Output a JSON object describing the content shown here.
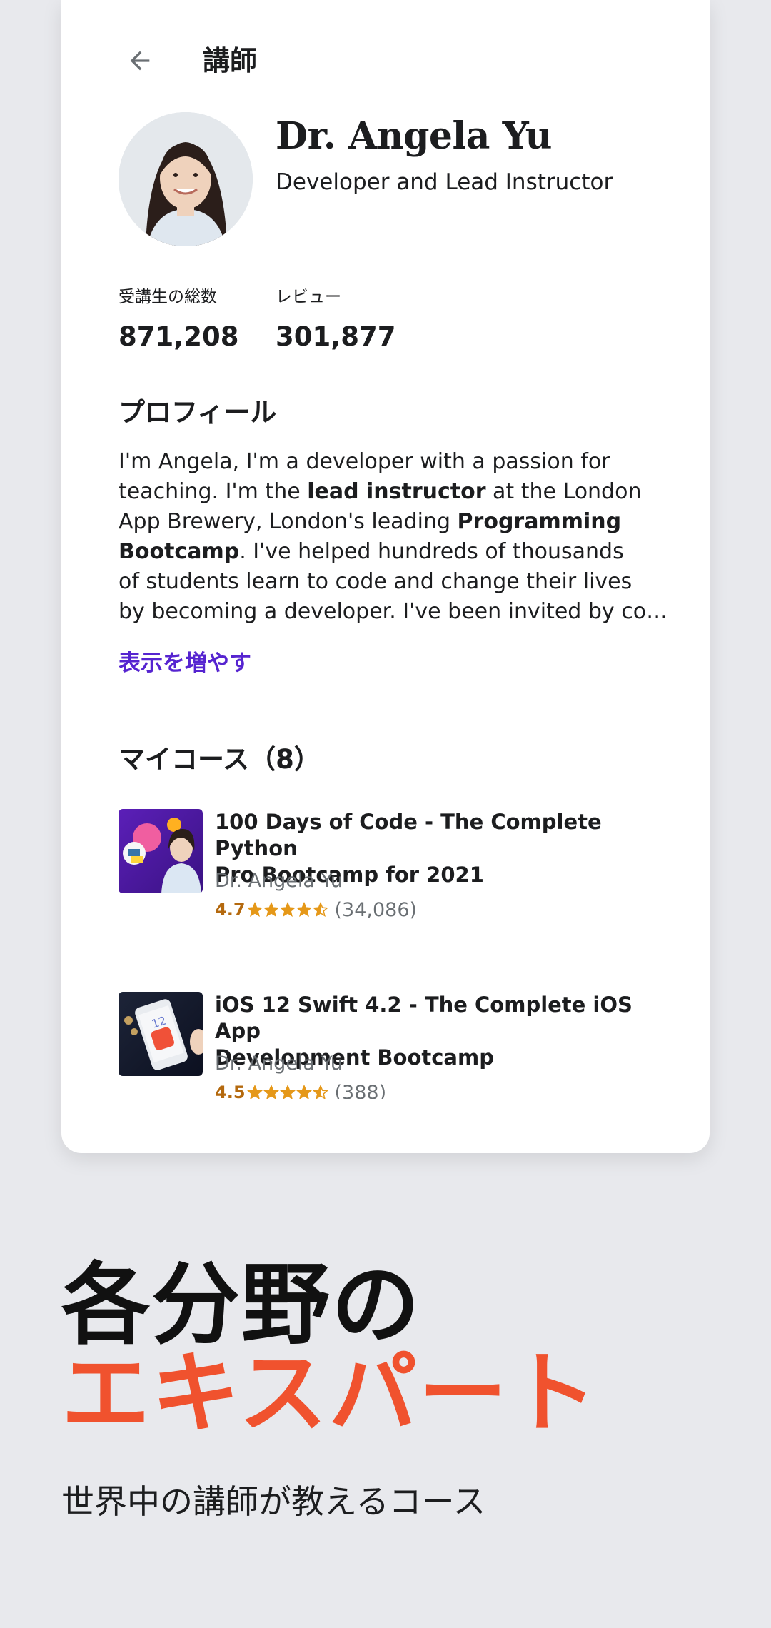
{
  "header": {
    "title": "講師",
    "back_icon": "arrow-left-icon"
  },
  "instructor": {
    "name": "Dr. Angela Yu",
    "tagline": "Developer and Lead Instructor",
    "stats": [
      {
        "label": "受講生の総数",
        "value": "871,208"
      },
      {
        "label": "レビュー",
        "value": "301,877"
      }
    ]
  },
  "profile": {
    "title": "プロフィール",
    "bio_lines": [
      {
        "parts": [
          {
            "t": "I'm Angela, I'm a developer with a passion for",
            "b": false
          }
        ]
      },
      {
        "parts": [
          {
            "t": "teaching. I'm the ",
            "b": false
          },
          {
            "t": "lead instructor",
            "b": true
          },
          {
            "t": " at the London",
            "b": false
          }
        ]
      },
      {
        "parts": [
          {
            "t": "App Brewery, London's leading ",
            "b": false
          },
          {
            "t": "Programming",
            "b": true
          }
        ]
      },
      {
        "parts": [
          {
            "t": "Bootcamp",
            "b": true
          },
          {
            "t": ". I've helped hundreds of thousands",
            "b": false
          }
        ]
      },
      {
        "parts": [
          {
            "t": "of students learn to code and change their lives",
            "b": false
          }
        ]
      },
      {
        "parts": [
          {
            "t": "by becoming a developer. I've been invited by co…",
            "b": false
          }
        ]
      }
    ],
    "show_more": "表示を増やす"
  },
  "courses": {
    "title": "マイコース（8）",
    "items": [
      {
        "title_line1": "100 Days of Code - The Complete Python",
        "title_line2": "Pro Bootcamp for 2021",
        "author": "Dr. Angela Yu",
        "rating": "4.7",
        "rating_value": 4.7,
        "count": "(34,086)"
      },
      {
        "title_line1": "iOS 12 Swift 4.2 - The Complete iOS App",
        "title_line2": "Development Bootcamp",
        "author": "Dr. Angela Yu",
        "rating": "4.5",
        "rating_value": 4.5,
        "count": "(388)"
      }
    ]
  },
  "promo": {
    "line1": "各分野の",
    "line2": "エキスパート",
    "subtitle": "世界中の講師が教えるコース"
  },
  "colors": {
    "background": "#e8e9ed",
    "accent_purple": "#5624d0",
    "accent_orange": "#f0522e",
    "star": "#e59819",
    "rating_text": "#b4690e"
  }
}
